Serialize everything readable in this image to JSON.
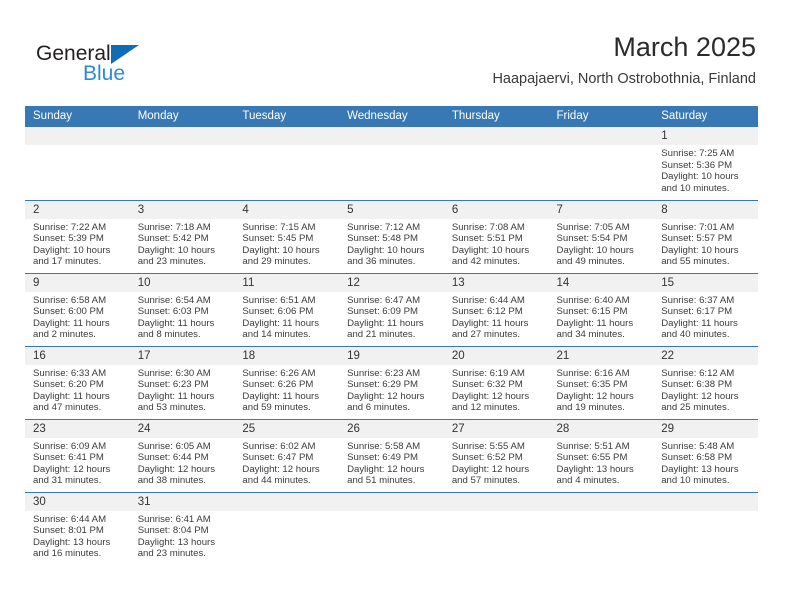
{
  "logo": {
    "word_one": "General",
    "word_two": "Blue",
    "triangle_color": "#0f6cb5",
    "blue_text_color": "#2a8bd5"
  },
  "header": {
    "title": "March 2025",
    "subtitle": "Haapajaervi, North Ostrobothnia, Finland",
    "accent_color": "#3878b4"
  },
  "calendar": {
    "weekday_headers": [
      "Sunday",
      "Monday",
      "Tuesday",
      "Wednesday",
      "Thursday",
      "Friday",
      "Saturday"
    ],
    "weeks": [
      [
        {
          "day": "",
          "sunrise": "",
          "sunset": "",
          "daylight_line1": "",
          "daylight_line2": ""
        },
        {
          "day": "",
          "sunrise": "",
          "sunset": "",
          "daylight_line1": "",
          "daylight_line2": ""
        },
        {
          "day": "",
          "sunrise": "",
          "sunset": "",
          "daylight_line1": "",
          "daylight_line2": ""
        },
        {
          "day": "",
          "sunrise": "",
          "sunset": "",
          "daylight_line1": "",
          "daylight_line2": ""
        },
        {
          "day": "",
          "sunrise": "",
          "sunset": "",
          "daylight_line1": "",
          "daylight_line2": ""
        },
        {
          "day": "",
          "sunrise": "",
          "sunset": "",
          "daylight_line1": "",
          "daylight_line2": ""
        },
        {
          "day": "1",
          "sunrise": "Sunrise: 7:25 AM",
          "sunset": "Sunset: 5:36 PM",
          "daylight_line1": "Daylight: 10 hours",
          "daylight_line2": "and 10 minutes."
        }
      ],
      [
        {
          "day": "2",
          "sunrise": "Sunrise: 7:22 AM",
          "sunset": "Sunset: 5:39 PM",
          "daylight_line1": "Daylight: 10 hours",
          "daylight_line2": "and 17 minutes."
        },
        {
          "day": "3",
          "sunrise": "Sunrise: 7:18 AM",
          "sunset": "Sunset: 5:42 PM",
          "daylight_line1": "Daylight: 10 hours",
          "daylight_line2": "and 23 minutes."
        },
        {
          "day": "4",
          "sunrise": "Sunrise: 7:15 AM",
          "sunset": "Sunset: 5:45 PM",
          "daylight_line1": "Daylight: 10 hours",
          "daylight_line2": "and 29 minutes."
        },
        {
          "day": "5",
          "sunrise": "Sunrise: 7:12 AM",
          "sunset": "Sunset: 5:48 PM",
          "daylight_line1": "Daylight: 10 hours",
          "daylight_line2": "and 36 minutes."
        },
        {
          "day": "6",
          "sunrise": "Sunrise: 7:08 AM",
          "sunset": "Sunset: 5:51 PM",
          "daylight_line1": "Daylight: 10 hours",
          "daylight_line2": "and 42 minutes."
        },
        {
          "day": "7",
          "sunrise": "Sunrise: 7:05 AM",
          "sunset": "Sunset: 5:54 PM",
          "daylight_line1": "Daylight: 10 hours",
          "daylight_line2": "and 49 minutes."
        },
        {
          "day": "8",
          "sunrise": "Sunrise: 7:01 AM",
          "sunset": "Sunset: 5:57 PM",
          "daylight_line1": "Daylight: 10 hours",
          "daylight_line2": "and 55 minutes."
        }
      ],
      [
        {
          "day": "9",
          "sunrise": "Sunrise: 6:58 AM",
          "sunset": "Sunset: 6:00 PM",
          "daylight_line1": "Daylight: 11 hours",
          "daylight_line2": "and 2 minutes."
        },
        {
          "day": "10",
          "sunrise": "Sunrise: 6:54 AM",
          "sunset": "Sunset: 6:03 PM",
          "daylight_line1": "Daylight: 11 hours",
          "daylight_line2": "and 8 minutes."
        },
        {
          "day": "11",
          "sunrise": "Sunrise: 6:51 AM",
          "sunset": "Sunset: 6:06 PM",
          "daylight_line1": "Daylight: 11 hours",
          "daylight_line2": "and 14 minutes."
        },
        {
          "day": "12",
          "sunrise": "Sunrise: 6:47 AM",
          "sunset": "Sunset: 6:09 PM",
          "daylight_line1": "Daylight: 11 hours",
          "daylight_line2": "and 21 minutes."
        },
        {
          "day": "13",
          "sunrise": "Sunrise: 6:44 AM",
          "sunset": "Sunset: 6:12 PM",
          "daylight_line1": "Daylight: 11 hours",
          "daylight_line2": "and 27 minutes."
        },
        {
          "day": "14",
          "sunrise": "Sunrise: 6:40 AM",
          "sunset": "Sunset: 6:15 PM",
          "daylight_line1": "Daylight: 11 hours",
          "daylight_line2": "and 34 minutes."
        },
        {
          "day": "15",
          "sunrise": "Sunrise: 6:37 AM",
          "sunset": "Sunset: 6:17 PM",
          "daylight_line1": "Daylight: 11 hours",
          "daylight_line2": "and 40 minutes."
        }
      ],
      [
        {
          "day": "16",
          "sunrise": "Sunrise: 6:33 AM",
          "sunset": "Sunset: 6:20 PM",
          "daylight_line1": "Daylight: 11 hours",
          "daylight_line2": "and 47 minutes."
        },
        {
          "day": "17",
          "sunrise": "Sunrise: 6:30 AM",
          "sunset": "Sunset: 6:23 PM",
          "daylight_line1": "Daylight: 11 hours",
          "daylight_line2": "and 53 minutes."
        },
        {
          "day": "18",
          "sunrise": "Sunrise: 6:26 AM",
          "sunset": "Sunset: 6:26 PM",
          "daylight_line1": "Daylight: 11 hours",
          "daylight_line2": "and 59 minutes."
        },
        {
          "day": "19",
          "sunrise": "Sunrise: 6:23 AM",
          "sunset": "Sunset: 6:29 PM",
          "daylight_line1": "Daylight: 12 hours",
          "daylight_line2": "and 6 minutes."
        },
        {
          "day": "20",
          "sunrise": "Sunrise: 6:19 AM",
          "sunset": "Sunset: 6:32 PM",
          "daylight_line1": "Daylight: 12 hours",
          "daylight_line2": "and 12 minutes."
        },
        {
          "day": "21",
          "sunrise": "Sunrise: 6:16 AM",
          "sunset": "Sunset: 6:35 PM",
          "daylight_line1": "Daylight: 12 hours",
          "daylight_line2": "and 19 minutes."
        },
        {
          "day": "22",
          "sunrise": "Sunrise: 6:12 AM",
          "sunset": "Sunset: 6:38 PM",
          "daylight_line1": "Daylight: 12 hours",
          "daylight_line2": "and 25 minutes."
        }
      ],
      [
        {
          "day": "23",
          "sunrise": "Sunrise: 6:09 AM",
          "sunset": "Sunset: 6:41 PM",
          "daylight_line1": "Daylight: 12 hours",
          "daylight_line2": "and 31 minutes."
        },
        {
          "day": "24",
          "sunrise": "Sunrise: 6:05 AM",
          "sunset": "Sunset: 6:44 PM",
          "daylight_line1": "Daylight: 12 hours",
          "daylight_line2": "and 38 minutes."
        },
        {
          "day": "25",
          "sunrise": "Sunrise: 6:02 AM",
          "sunset": "Sunset: 6:47 PM",
          "daylight_line1": "Daylight: 12 hours",
          "daylight_line2": "and 44 minutes."
        },
        {
          "day": "26",
          "sunrise": "Sunrise: 5:58 AM",
          "sunset": "Sunset: 6:49 PM",
          "daylight_line1": "Daylight: 12 hours",
          "daylight_line2": "and 51 minutes."
        },
        {
          "day": "27",
          "sunrise": "Sunrise: 5:55 AM",
          "sunset": "Sunset: 6:52 PM",
          "daylight_line1": "Daylight: 12 hours",
          "daylight_line2": "and 57 minutes."
        },
        {
          "day": "28",
          "sunrise": "Sunrise: 5:51 AM",
          "sunset": "Sunset: 6:55 PM",
          "daylight_line1": "Daylight: 13 hours",
          "daylight_line2": "and 4 minutes."
        },
        {
          "day": "29",
          "sunrise": "Sunrise: 5:48 AM",
          "sunset": "Sunset: 6:58 PM",
          "daylight_line1": "Daylight: 13 hours",
          "daylight_line2": "and 10 minutes."
        }
      ],
      [
        {
          "day": "30",
          "sunrise": "Sunrise: 6:44 AM",
          "sunset": "Sunset: 8:01 PM",
          "daylight_line1": "Daylight: 13 hours",
          "daylight_line2": "and 16 minutes."
        },
        {
          "day": "31",
          "sunrise": "Sunrise: 6:41 AM",
          "sunset": "Sunset: 8:04 PM",
          "daylight_line1": "Daylight: 13 hours",
          "daylight_line2": "and 23 minutes."
        },
        {
          "day": "",
          "sunrise": "",
          "sunset": "",
          "daylight_line1": "",
          "daylight_line2": ""
        },
        {
          "day": "",
          "sunrise": "",
          "sunset": "",
          "daylight_line1": "",
          "daylight_line2": ""
        },
        {
          "day": "",
          "sunrise": "",
          "sunset": "",
          "daylight_line1": "",
          "daylight_line2": ""
        },
        {
          "day": "",
          "sunrise": "",
          "sunset": "",
          "daylight_line1": "",
          "daylight_line2": ""
        },
        {
          "day": "",
          "sunrise": "",
          "sunset": "",
          "daylight_line1": "",
          "daylight_line2": ""
        }
      ]
    ]
  }
}
